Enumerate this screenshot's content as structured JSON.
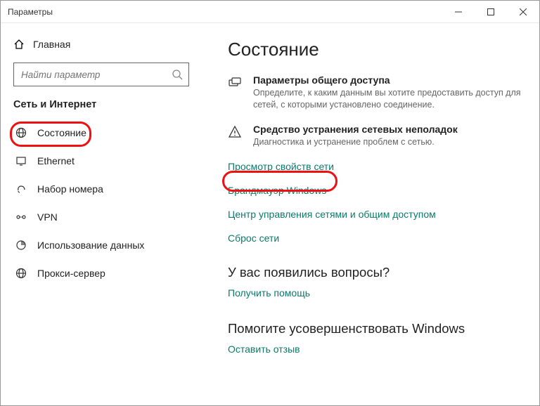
{
  "window": {
    "title": "Параметры"
  },
  "sidebar": {
    "home": "Главная",
    "search_placeholder": "Найти параметр",
    "group": "Сеть и Интернет",
    "items": [
      {
        "label": "Состояние"
      },
      {
        "label": "Ethernet"
      },
      {
        "label": "Набор номера"
      },
      {
        "label": "VPN"
      },
      {
        "label": "Использование данных"
      },
      {
        "label": "Прокси-сервер"
      }
    ]
  },
  "main": {
    "title": "Состояние",
    "share": {
      "title": "Параметры общего доступа",
      "desc": "Определите, к каким данным вы хотите предоставить доступ для сетей, с которыми установлено соединение."
    },
    "trouble": {
      "title": "Средство устранения сетевых неполадок",
      "desc": "Диагностика и устранение проблем с сетью."
    },
    "links": {
      "props": "Просмотр свойств сети",
      "firewall": "Брандмауэр Windows",
      "center": "Центр управления сетями и общим доступом",
      "reset": "Сброс сети"
    },
    "help": {
      "heading": "У вас появились вопросы?",
      "link": "Получить помощь"
    },
    "feedback": {
      "heading": "Помогите усовершенствовать Windows",
      "link": "Оставить отзыв"
    }
  }
}
